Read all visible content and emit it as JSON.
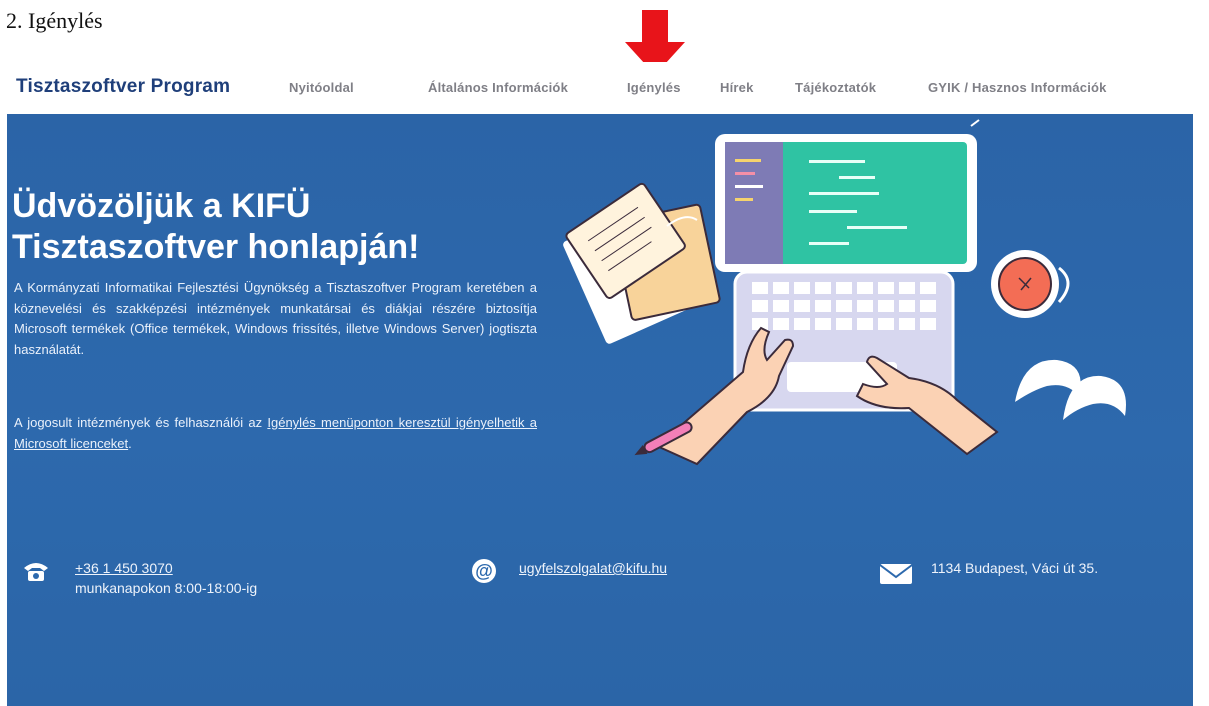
{
  "doc_heading": "2.  Igénylés",
  "nav": {
    "brand": "Tisztaszoftver Program",
    "items": [
      {
        "label": "Nyitóoldal"
      },
      {
        "label": "Általános Információk"
      },
      {
        "label": "Igénylés"
      },
      {
        "label": "Hírek"
      },
      {
        "label": "Tájékoztatók"
      },
      {
        "label": "GYIK / Hasznos Információk"
      }
    ]
  },
  "hero": {
    "title_line1": "Üdvözöljük a KIFÜ",
    "title_line2": "Tisztaszoftver honlapján!",
    "paragraph1": "A Kormányzati Informatikai Fejlesztési Ügynökség a Tisztaszoftver Program keretében a köznevelési és szakképzési intézmények munkatársai és diákjai részére biztosítja Microsoft termékek (Office termékek, Windows frissítés, illetve Windows Server) jogtiszta használatát.",
    "paragraph2_prefix": "A jogosult intézmények és felhasználói az ",
    "paragraph2_link": "Igénylés menüponton keresztül igényelhetik a Microsoft licenceket",
    "paragraph2_suffix": "."
  },
  "contact": {
    "phone": "+36 1 450 3070",
    "hours": "munkanapokon 8:00-18:00-ig",
    "email": "ugyfelszolgalat@kifu.hu",
    "address": "1134 Budapest, Váci út 35."
  },
  "icons": {
    "arrow": "down-arrow-icon",
    "phone": "telephone-icon",
    "email": "at-sign-icon",
    "address": "envelope-icon"
  },
  "colors": {
    "brand": "#1f3f7a",
    "hero_bg": "#2d69ad",
    "arrow": "#e8141a",
    "nav_text": "#7f7f86"
  }
}
